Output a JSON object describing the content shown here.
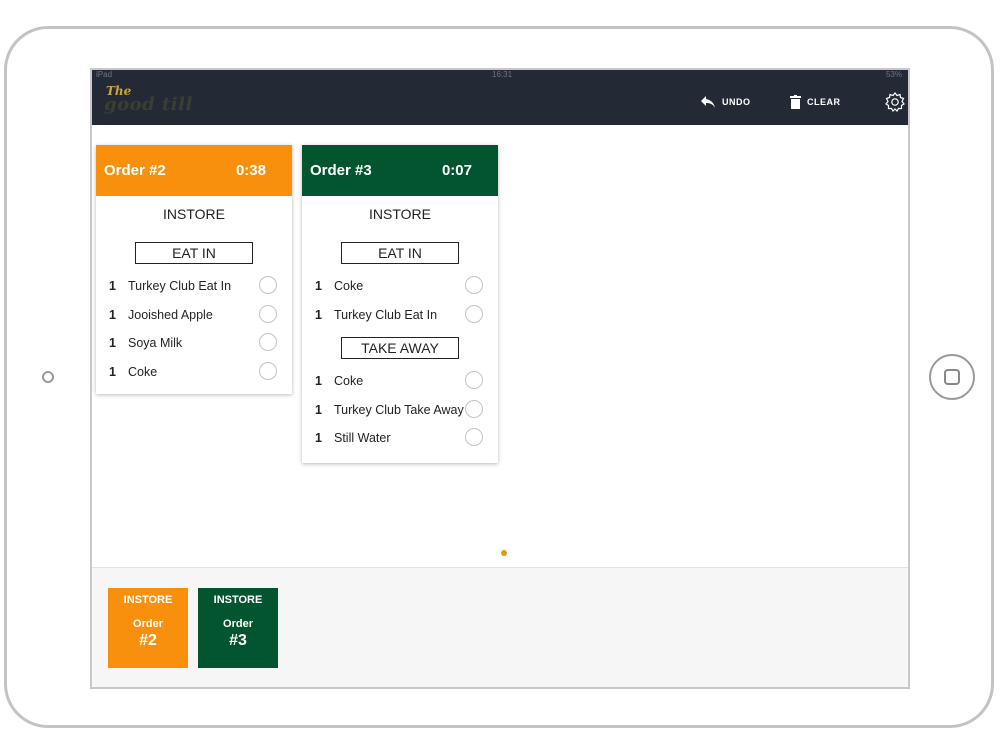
{
  "statusbar": {
    "left": "iPad",
    "time": "16:31",
    "battery": "53%"
  },
  "brand": {
    "the": "The",
    "name": "good till"
  },
  "toolbar": {
    "undo_label": "UNDO",
    "clear_label": "CLEAR",
    "undo_icon": "undo-arrow-icon",
    "clear_icon": "trash-icon",
    "settings_icon": "gear-icon"
  },
  "colors": {
    "topbar": "#242a35",
    "orange": "#f8900d",
    "green": "#03552f",
    "page_dot": "#dc9a16"
  },
  "orders": [
    {
      "title": "Order #2",
      "timer": "0:38",
      "type": "INSTORE",
      "color": "#f8900d",
      "sections": [
        {
          "label": "EAT IN",
          "items": [
            {
              "qty": "1",
              "name": "Turkey Club Eat In"
            },
            {
              "qty": "1",
              "name": "Jooished Apple"
            },
            {
              "qty": "1",
              "name": "Soya Milk"
            },
            {
              "qty": "1",
              "name": "Coke"
            }
          ]
        }
      ]
    },
    {
      "title": "Order #3",
      "timer": "0:07",
      "type": "INSTORE",
      "color": "#03552f",
      "sections": [
        {
          "label": "EAT IN",
          "items": [
            {
              "qty": "1",
              "name": "Coke"
            },
            {
              "qty": "1",
              "name": "Turkey Club Eat In"
            }
          ]
        },
        {
          "label": "TAKE AWAY",
          "items": [
            {
              "qty": "1",
              "name": "Coke"
            },
            {
              "qty": "1",
              "name": "Turkey Club Take Away"
            },
            {
              "qty": "1",
              "name": "Still Water"
            }
          ]
        }
      ]
    }
  ],
  "tiles": [
    {
      "type": "INSTORE",
      "label": "Order",
      "number": "#2",
      "color": "#f8900d"
    },
    {
      "type": "INSTORE",
      "label": "Order",
      "number": "#3",
      "color": "#03552f"
    }
  ]
}
